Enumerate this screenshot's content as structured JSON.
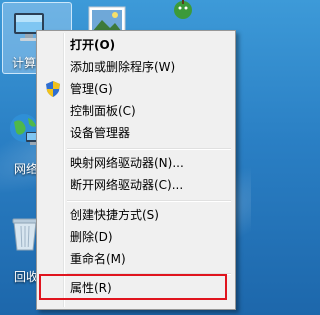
{
  "desktop": {
    "icons": [
      {
        "name": "computer",
        "label": "计算机"
      },
      {
        "name": "network",
        "label": "网络"
      },
      {
        "name": "recycle-bin",
        "label": "回收站"
      }
    ]
  },
  "context_menu": {
    "items": [
      {
        "id": "open",
        "label": "打开(O)",
        "bold": true
      },
      {
        "id": "add-remove-programs",
        "label": "添加或删除程序(W)"
      },
      {
        "id": "manage",
        "label": "管理(G)",
        "icon": "uac-shield-icon"
      },
      {
        "id": "control-panel",
        "label": "控制面板(C)"
      },
      {
        "id": "device-manager",
        "label": "设备管理器"
      },
      {
        "id": "map-network-drive",
        "label": "映射网络驱动器(N)..."
      },
      {
        "id": "disconnect-network-drive",
        "label": "断开网络驱动器(C)..."
      },
      {
        "id": "create-shortcut",
        "label": "创建快捷方式(S)"
      },
      {
        "id": "delete",
        "label": "删除(D)"
      },
      {
        "id": "rename",
        "label": "重命名(M)"
      },
      {
        "id": "properties",
        "label": "属性(R)",
        "highlighted": true
      }
    ]
  },
  "colors": {
    "highlight_border": "#e0141e",
    "menu_background": "#f0f0f0"
  }
}
